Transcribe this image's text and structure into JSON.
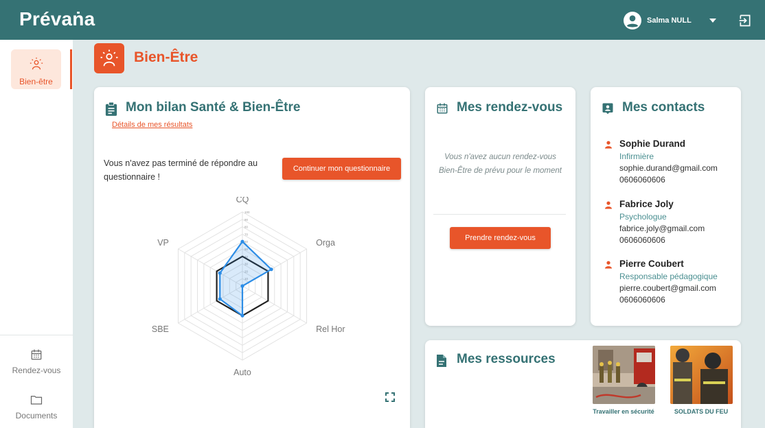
{
  "app": {
    "logo": "Prévaṅa",
    "user_name": "Salma NULL"
  },
  "colors": {
    "primary": "#357274",
    "accent": "#e8552a",
    "background": "#dfe9ea"
  },
  "icons": {
    "user": "account-circle-icon",
    "dropdown": "caret-down-icon",
    "logout": "logout-icon",
    "wellbeing": "wellbeing-sun-person-icon",
    "clipboard": "clipboard-icon",
    "calendar": "calendar-icon",
    "contacts": "contact-card-icon",
    "person": "person-icon",
    "document": "document-icon",
    "folder": "folder-icon",
    "expand": "fullscreen-icon"
  },
  "sidebar": {
    "items": [
      {
        "label": "Bien-être",
        "active": true
      },
      {
        "label": "Rendez-vous",
        "active": false
      },
      {
        "label": "Documents",
        "active": false
      }
    ]
  },
  "page": {
    "title": "Bien-Être"
  },
  "bilan": {
    "title": "Mon bilan Santé & Bien-Être",
    "details_link": "Détails de mes résultats",
    "notice": "Vous n'avez pas terminé de répondre au questionnaire !",
    "continue_button": "Continuer mon questionnaire"
  },
  "chart_data": {
    "type": "radar",
    "axes": [
      "CQ",
      "Orga",
      "Rel Hor",
      "Auto",
      "SBE",
      "VP"
    ],
    "rmax": 100,
    "tick_labels": [
      "10",
      "20",
      "30",
      "40",
      "50",
      "60",
      "70",
      "80",
      "90",
      "100"
    ],
    "series": [
      {
        "color": "#222222",
        "values": [
          40,
          40,
          40,
          40,
          40,
          40
        ]
      },
      {
        "color": "#2d8de6",
        "values": [
          60,
          45,
          0,
          40,
          35,
          35
        ]
      }
    ]
  },
  "rdv": {
    "title": "Mes rendez-vous",
    "empty_text": "Vous n'avez aucun rendez-vous Bien-Être de prévu pour le moment",
    "book_button": "Prendre rendez-vous"
  },
  "contacts": {
    "title": "Mes contacts",
    "list": [
      {
        "name": "Sophie Durand",
        "role": "Infirmière",
        "email": "sophie.durand@gmail.com",
        "phone": "0606060606"
      },
      {
        "name": "Fabrice Joly",
        "role": "Psychologue",
        "email": "fabrice.joly@gmail.com",
        "phone": "0606060606"
      },
      {
        "name": "Pierre Coubert",
        "role": "Responsable pédagogique",
        "email": "pierre.coubert@gmail.com",
        "phone": "0606060606"
      }
    ]
  },
  "resources": {
    "title": "Mes ressources",
    "items": [
      {
        "caption": "Travailler en sécurité"
      },
      {
        "caption": "SOLDATS DU FEU"
      }
    ]
  }
}
